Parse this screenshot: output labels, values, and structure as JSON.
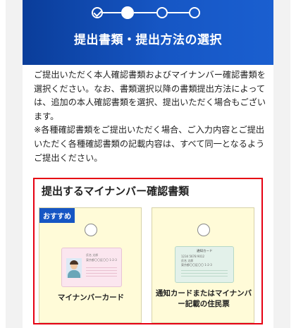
{
  "header": {
    "title": "提出書類・提出方法の選択",
    "steps": [
      "done",
      "current",
      "pending",
      "pending"
    ]
  },
  "intro": {
    "paragraph": "ご提出いただく本人確認書類およびマイナンバー確認書類を選択ください。なお、書類選択以降の書類提出方法によっては、追加の本人確認書類を選択、提出いただく場合もございます。\n※各種確認書類をご提出いただく場合、ご入力内容とご提出いただく各種確認書類の記載内容は、すべて同一となるようご提出ください。"
  },
  "selection": {
    "section_title": "提出するマイナンバー確認書類",
    "highlight_color": "#e60012",
    "options": [
      {
        "badge": "おすすめ",
        "label": "マイナンバーカード",
        "selected": false,
        "illustration": {
          "line1": "氏名 太郎",
          "line2": "東京都〇〇区〇〇 1-2-3"
        }
      },
      {
        "label": "通知カードまたはマイナンバー記載の住民票",
        "selected": false,
        "illustration": {
          "title": "通知カード",
          "line0": "1234 5678 9012",
          "line1": "氏名 太郎",
          "line2": "東京都〇〇区〇〇 1-2-3"
        }
      }
    ]
  },
  "colors": {
    "header_start": "#0a3d9a",
    "header_end": "#1a5fd0",
    "card_bg": "#fffbd8",
    "badge_bg": "#1656c4"
  }
}
